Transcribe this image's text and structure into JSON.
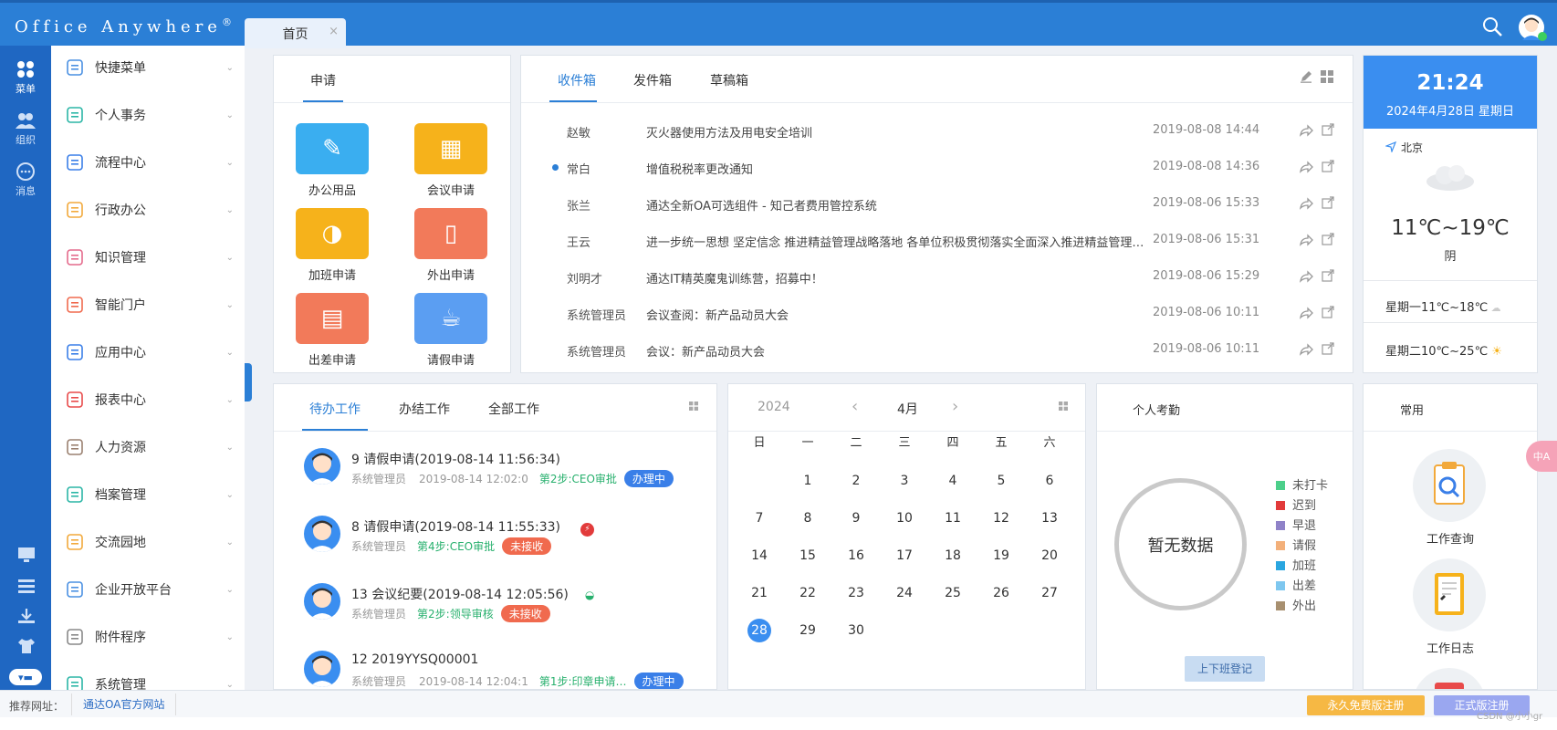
{
  "header": {
    "brand": "Office Anywhere",
    "brand_mark": "®",
    "tab_home": "首页",
    "tab_close": "×"
  },
  "rail": {
    "items": [
      "菜单",
      "组织",
      "消息"
    ]
  },
  "menu": {
    "items": [
      {
        "label": "快捷菜单",
        "icon": "shortcut-icon"
      },
      {
        "label": "个人事务",
        "icon": "person-icon"
      },
      {
        "label": "流程中心",
        "icon": "flow-icon"
      },
      {
        "label": "行政办公",
        "icon": "briefcase-icon"
      },
      {
        "label": "知识管理",
        "icon": "knowledge-icon"
      },
      {
        "label": "智能门户",
        "icon": "portal-icon"
      },
      {
        "label": "应用中心",
        "icon": "app-center-icon"
      },
      {
        "label": "报表中心",
        "icon": "report-icon"
      },
      {
        "label": "人力资源",
        "icon": "hr-icon"
      },
      {
        "label": "档案管理",
        "icon": "archive-icon"
      },
      {
        "label": "交流园地",
        "icon": "cup-icon"
      },
      {
        "label": "企业开放平台",
        "icon": "cube-icon"
      },
      {
        "label": "附件程序",
        "icon": "attachment-icon"
      },
      {
        "label": "系统管理",
        "icon": "system-icon"
      }
    ],
    "chevron": "⌄"
  },
  "apply": {
    "tab": "申请",
    "items": [
      {
        "label": "办公用品",
        "color": "#3aaef0"
      },
      {
        "label": "会议申请",
        "color": "#f6b21b"
      },
      {
        "label": "加班申请",
        "color": "#f6b21b"
      },
      {
        "label": "外出申请",
        "color": "#f27a5a"
      },
      {
        "label": "出差申请",
        "color": "#f27a5a"
      },
      {
        "label": "请假申请",
        "color": "#5b9ef2"
      }
    ]
  },
  "inbox": {
    "tabs": [
      "收件箱",
      "发件箱",
      "草稿箱"
    ],
    "rows": [
      {
        "sender": "赵敏",
        "subject": "灭火器使用方法及用电安全培训",
        "date": "2019-08-08 14:44",
        "unread": false
      },
      {
        "sender": "常白",
        "subject": "增值税税率更改通知",
        "date": "2019-08-08 14:36",
        "unread": true
      },
      {
        "sender": "张兰",
        "subject": "通达全新OA可选组件 - 知己者费用管控系统",
        "date": "2019-08-06 15:33",
        "unread": false
      },
      {
        "sender": "王云",
        "subject": "进一步统一思想 坚定信念 推进精益管理战略落地 各单位积极贯彻落实全面深入推进精益管理…",
        "date": "2019-08-06 15:31",
        "unread": false
      },
      {
        "sender": "刘明才",
        "subject": "通达IT精英魔鬼训练营，招募中！",
        "date": "2019-08-06 15:29",
        "unread": false
      },
      {
        "sender": "系统管理员",
        "subject": "会议查阅：新产品动员大会",
        "date": "2019-08-06 10:11",
        "unread": false
      },
      {
        "sender": "系统管理员",
        "subject": "会议：新产品动员大会",
        "date": "2019-08-06 10:11",
        "unread": false
      }
    ]
  },
  "weather": {
    "time": "21:24",
    "date": "2024年4月28日  星期日",
    "city": "北京",
    "temp": "11℃~19℃",
    "condition": "阴",
    "forecast": [
      {
        "text": "星期一11℃~18℃",
        "icon": "cloud-sun-icon"
      },
      {
        "text": "星期二10℃~25℃",
        "icon": "sun-icon"
      }
    ]
  },
  "todo": {
    "tabs": [
      "待办工作",
      "办结工作",
      "全部工作"
    ],
    "items": [
      {
        "title": "9   请假申请(2019-08-14 11:56:34)",
        "user": "系统管理员",
        "time": "2019-08-14 12:02:0",
        "step": "第2步:CEO审批",
        "status": "办理中",
        "status_type": "blue"
      },
      {
        "title": "8   请假申请(2019-08-14 11:55:33)",
        "user": "系统管理员",
        "time": "",
        "step": "第4步:CEO审批",
        "status": "未接收",
        "status_type": "red"
      },
      {
        "title": "13   会议纪要(2019-08-14 12:05:56)",
        "user": "系统管理员",
        "time": "",
        "step": "第2步:领导审核",
        "status": "未接收",
        "status_type": "red"
      },
      {
        "title": "12   2019YYSQ00001",
        "user": "系统管理员",
        "time": "2019-08-14 12:04:1",
        "step": "第1步:印章申请…",
        "status": "办理中",
        "status_type": "blue"
      }
    ]
  },
  "calendar": {
    "year": "2024",
    "month": "4月",
    "weekdays": [
      "日",
      "一",
      "二",
      "三",
      "四",
      "五",
      "六"
    ],
    "first_weekday": 1,
    "days": 30,
    "today": 28
  },
  "attendance": {
    "title": "个人考勤",
    "empty": "暂无数据",
    "legend": [
      {
        "label": "未打卡",
        "color": "#4ccf8a"
      },
      {
        "label": "迟到",
        "color": "#e23b3b"
      },
      {
        "label": "早退",
        "color": "#8f82c8"
      },
      {
        "label": "请假",
        "color": "#f3b07a"
      },
      {
        "label": "加班",
        "color": "#2aa6e0"
      },
      {
        "label": "出差",
        "color": "#7ec7ef"
      },
      {
        "label": "外出",
        "color": "#a89070"
      }
    ],
    "button": "上下班登记"
  },
  "common": {
    "title": "常用",
    "items": [
      "工作查询",
      "工作日志"
    ]
  },
  "footer": {
    "label": "推荐网址：",
    "site": "通达OA官方网站",
    "btn_free": "永久免费版注册",
    "btn_reg": "正式版注册",
    "watermark": "CSDN @小小gr"
  },
  "fab": "中A"
}
